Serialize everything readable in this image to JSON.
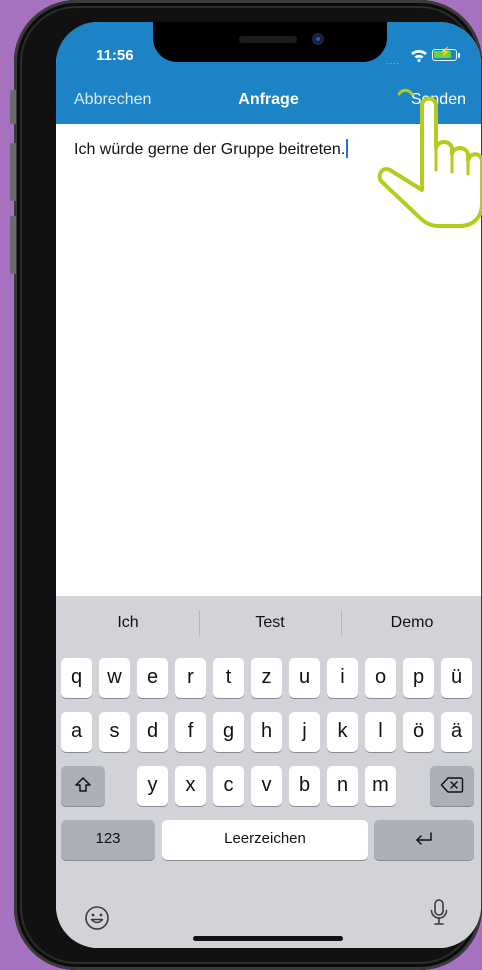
{
  "status_bar": {
    "time": "11:56",
    "signal": "....",
    "wifi_icon": "wifi-icon",
    "battery_icon": "battery-charging-icon"
  },
  "nav": {
    "cancel_label": "Abbrechen",
    "title": "Anfrage",
    "send_label": "Senden"
  },
  "message": {
    "text": "Ich würde gerne der Gruppe beitreten."
  },
  "keyboard": {
    "suggestions": [
      "Ich",
      "Test",
      "Demo"
    ],
    "rows": [
      [
        "q",
        "w",
        "e",
        "r",
        "t",
        "z",
        "u",
        "i",
        "o",
        "p",
        "ü"
      ],
      [
        "a",
        "s",
        "d",
        "f",
        "g",
        "h",
        "j",
        "k",
        "l",
        "ö",
        "ä"
      ],
      [
        "y",
        "x",
        "c",
        "v",
        "b",
        "n",
        "m"
      ]
    ],
    "numbers_label": "123",
    "space_label": "Leerzeichen",
    "shift_icon": "shift-icon",
    "backspace_icon": "backspace-icon",
    "return_icon": "return-icon",
    "emoji_icon": "emoji-icon",
    "mic_icon": "microphone-icon"
  },
  "overlay": {
    "pointer_icon": "hand-pointer-icon",
    "color": "#b5cc1e"
  },
  "colors": {
    "background": "#a672bf",
    "header": "#1c84c6",
    "keyboard": "#d1d3d9",
    "caret": "#1a73e8"
  }
}
